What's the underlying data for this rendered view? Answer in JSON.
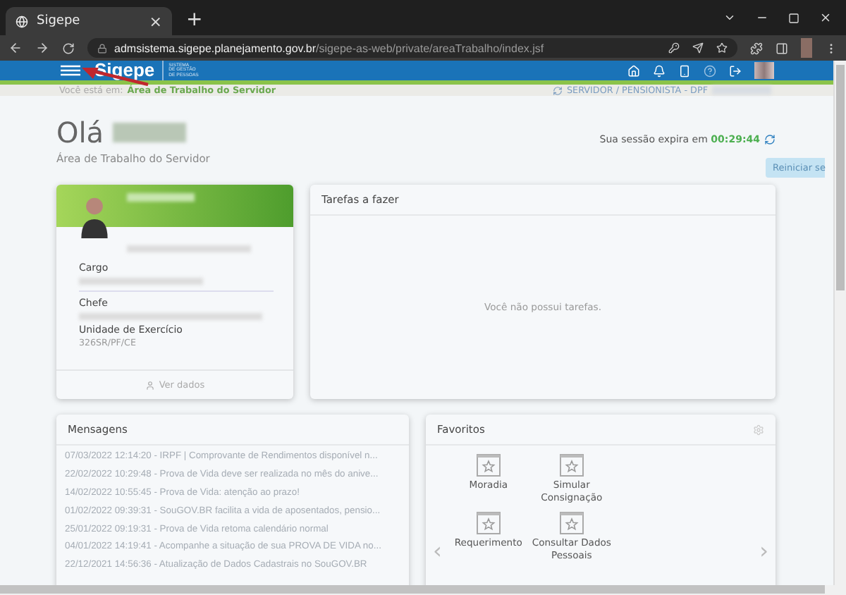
{
  "browser": {
    "tab_title": "Sigepe",
    "tab_close": "×",
    "new_tab": "+",
    "url_host": "admsistema.sigepe.planejamento.gov.br",
    "url_path": "/sigepe-as-web/private/areaTrabalho/index.jsf"
  },
  "header": {
    "logo": "Sigepe",
    "logo_subtitle": [
      "SISTEMA",
      "DE GESTÃO",
      "DE PESSOAS"
    ]
  },
  "breadcrumb": {
    "prefix": "Você está em:",
    "current": "Área de Trabalho do Servidor",
    "profile": "SERVIDOR / PENSIONISTA - DPF"
  },
  "greeting": "Olá",
  "subtitle": "Área de Trabalho do Servidor",
  "session": {
    "label": "Sua sessão expira em",
    "time": "00:29:44",
    "tooltip": "Reiniciar se"
  },
  "profile": {
    "fields": [
      {
        "label": "Cargo"
      },
      {
        "label": "Chefe"
      },
      {
        "label": "Unidade de Exercício",
        "value": "326SR/PF/CE"
      }
    ],
    "link": "Ver dados"
  },
  "tasks": {
    "title": "Tarefas a fazer",
    "empty": "Você não possui tarefas."
  },
  "messages": {
    "title": "Mensagens",
    "items": [
      "07/03/2022 12:14:20 - IRPF | Comprovante de Rendimentos disponível n...",
      "22/02/2022 10:29:48 - Prova de Vida deve ser realizada no mês do anive...",
      "14/02/2022 10:55:45 - Prova de Vida: atenção ao prazo!",
      "01/02/2022 09:39:31 - SouGOV.BR facilita a vida de aposentados, pensio...",
      "25/01/2022 09:19:31 - Prova de Vida retoma calendário normal",
      "04/01/2022 14:19:41 - Acompanhe a situação de sua PROVA DE VIDA no...",
      "22/12/2021 14:56:36 - Atualização de Dados Cadastrais no SouGOV.BR"
    ]
  },
  "favorites": {
    "title": "Favoritos",
    "items": [
      "Moradia",
      "Simular Consignação",
      "Requerimento",
      "Consultar Dados Pessoais"
    ],
    "prev": "‹",
    "next": "›"
  }
}
